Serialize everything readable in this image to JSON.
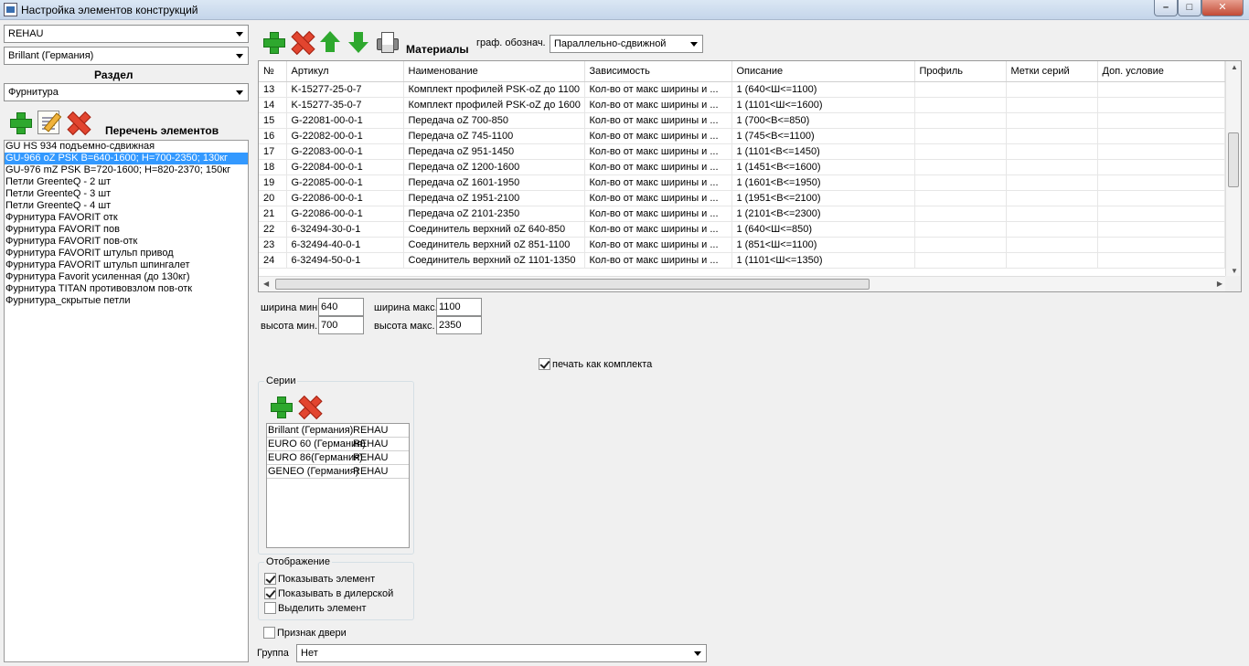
{
  "window": {
    "title": "Настройка элементов конструкций",
    "min_label": "–",
    "max_label": "□",
    "close_label": "✕"
  },
  "left": {
    "combo1": "REHAU",
    "combo2": "Brillant (Германия)",
    "section_label": "Раздел",
    "combo3": "Фурнитура",
    "list_label": "Перечень элементов",
    "items": [
      "GU HS 934 подъемно-сдвижная",
      "GU-966 oZ PSK B=640-1600; H=700-2350; 130кг",
      "GU-976 mZ PSK B=720-1600; H=820-2370; 150кг",
      "Петли GreenteQ - 2 шт",
      "Петли GreenteQ - 3 шт",
      "Петли GreenteQ - 4 шт",
      "Фурнитура FAVORIT отк",
      "Фурнитура FAVORIT пов",
      "Фурнитура FAVORIT пов-отк",
      "Фурнитура FAVORIT штульп привод",
      "Фурнитура FAVORIT штульп шпингалет",
      "Фурнитура Favorit усиленная (до 130кг)",
      "Фурнитура TITAN противовзлом пов-отк",
      "Фурнитура_скрытые петли"
    ],
    "selected_index": 1
  },
  "materials": {
    "label": "Материалы",
    "graph_label": "граф. обознач.",
    "graph_value": "Параллельно-сдвижной"
  },
  "grid": {
    "columns": [
      "№",
      "Артикул",
      "Наименование",
      "Зависимость",
      "Описание",
      "Профиль",
      "Метки серий",
      "Доп. условие"
    ],
    "rows": [
      [
        "13",
        "K-15277-25-0-7",
        "Комплект профилей PSK-oZ до 1100",
        "Кол-во от макс ширины и ...",
        "1 (640<Ш<=1100)",
        "",
        "",
        ""
      ],
      [
        "14",
        "K-15277-35-0-7",
        "Комплект профилей PSK-oZ до 1600",
        "Кол-во от макс ширины и ...",
        "1 (1101<Ш<=1600)",
        "",
        "",
        ""
      ],
      [
        "15",
        "G-22081-00-0-1",
        "Передача oZ 700-850",
        "Кол-во от макс ширины и ...",
        "1 (700<B<=850)",
        "",
        "",
        ""
      ],
      [
        "16",
        "G-22082-00-0-1",
        "Передача oZ 745-1100",
        "Кол-во от макс ширины и ...",
        "1 (745<B<=1100)",
        "",
        "",
        ""
      ],
      [
        "17",
        "G-22083-00-0-1",
        "Передача oZ 951-1450",
        "Кол-во от макс ширины и ...",
        "1 (1101<B<=1450)",
        "",
        "",
        ""
      ],
      [
        "18",
        "G-22084-00-0-1",
        "Передача oZ 1200-1600",
        "Кол-во от макс ширины и ...",
        "1 (1451<B<=1600)",
        "",
        "",
        ""
      ],
      [
        "19",
        "G-22085-00-0-1",
        "Передача oZ 1601-1950",
        "Кол-во от макс ширины и ...",
        "1 (1601<B<=1950)",
        "",
        "",
        ""
      ],
      [
        "20",
        "G-22086-00-0-1",
        "Передача oZ 1951-2100",
        "Кол-во от макс ширины и ...",
        "1 (1951<B<=2100)",
        "",
        "",
        ""
      ],
      [
        "21",
        "G-22086-00-0-1",
        "Передача oZ 2101-2350",
        "Кол-во от макс ширины и ...",
        "1 (2101<B<=2300)",
        "",
        "",
        ""
      ],
      [
        "22",
        "6-32494-30-0-1",
        "Соединитель верхний oZ 640-850",
        "Кол-во от макс ширины и ...",
        "1 (640<Ш<=850)",
        "",
        "",
        ""
      ],
      [
        "23",
        "6-32494-40-0-1",
        "Соединитель верхний oZ 851-1100",
        "Кол-во от макс ширины и ...",
        "1 (851<Ш<=1100)",
        "",
        "",
        ""
      ],
      [
        "24",
        "6-32494-50-0-1",
        "Соединитель верхний oZ 1101-1350",
        "Кол-во от макс ширины и ...",
        "1 (1101<Ш<=1350)",
        "",
        "",
        ""
      ]
    ]
  },
  "dims": {
    "width_min_label": "ширина мин.",
    "width_min": "640",
    "width_max_label": "ширина макс.",
    "width_max": "1100",
    "height_min_label": "высота мин.",
    "height_min": "700",
    "height_max_label": "высота макс.",
    "height_max": "2350"
  },
  "print_kit": {
    "label": "печать как комплекта",
    "checked": true
  },
  "series": {
    "title": "Серии",
    "rows": [
      [
        "Brillant (Германия)",
        "REHAU"
      ],
      [
        "EURO 60 (Германия)",
        "REHAU"
      ],
      [
        "EURO 86(Германия)",
        "REHAU"
      ],
      [
        "GENEO (Германия)",
        "REHAU"
      ]
    ]
  },
  "display": {
    "title": "Отображение",
    "show_element": {
      "label": "Показывать элемент",
      "checked": true
    },
    "show_dealer": {
      "label": "Показывать в дилерской",
      "checked": true
    },
    "highlight": {
      "label": "Выделить элемент",
      "checked": false
    }
  },
  "door_sign": {
    "label": "Признак двери",
    "checked": false
  },
  "group": {
    "label": "Группа",
    "value": "Нет"
  },
  "colors": {
    "selection": "#3399ff",
    "plus": "#2ea82e",
    "delete": "#e2452f"
  }
}
